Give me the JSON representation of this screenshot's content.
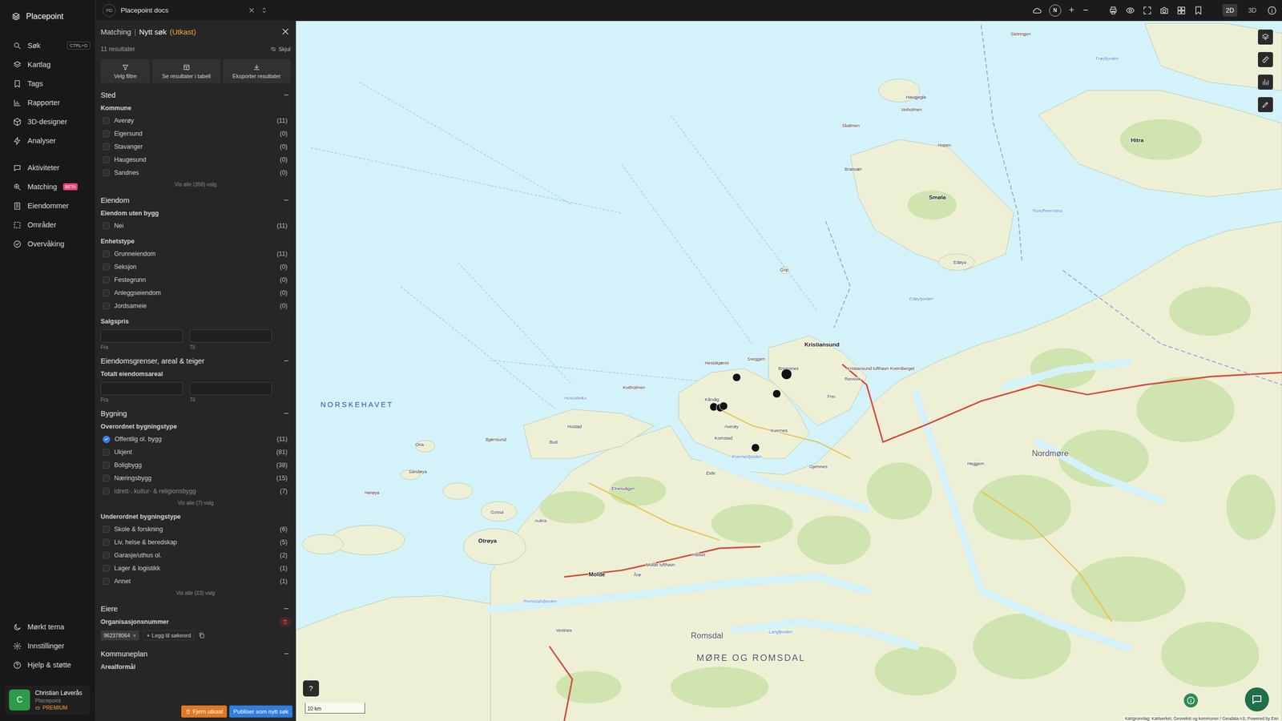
{
  "app": {
    "name": "Placepoint"
  },
  "nav": {
    "groups": [
      [
        {
          "label": "Søk",
          "shortcut": "CTRL+G"
        },
        {
          "label": "Kartlag"
        },
        {
          "label": "Tags"
        },
        {
          "label": "Rapporter"
        },
        {
          "label": "3D-designer"
        },
        {
          "label": "Analyser"
        }
      ],
      [
        {
          "label": "Aktiviteter"
        },
        {
          "label": "Matching",
          "badge": "BETA"
        },
        {
          "label": "Eiendommer"
        },
        {
          "label": "Områder"
        },
        {
          "label": "Overvåking"
        }
      ]
    ],
    "bottom": [
      {
        "label": "Mørkt tema"
      },
      {
        "label": "Innstillinger"
      },
      {
        "label": "Hjelp & støtte"
      }
    ],
    "user": {
      "initial": "C",
      "name": "Christian Løverås",
      "org": "Placepoint",
      "plan": "PREMIUM"
    }
  },
  "topbar": {
    "workspace_badge": "PD",
    "workspace": "Placepoint docs",
    "compass": "N",
    "zoom_in": "+",
    "zoom_out": "−",
    "views": [
      {
        "label": "2D",
        "selected": true
      },
      {
        "label": "3D",
        "selected": false
      }
    ]
  },
  "panel": {
    "breadcrumb": "Matching",
    "separator": "|",
    "title": "Nytt søk",
    "status": "(Utkast)",
    "results": "11 resultater",
    "hide": "Skjul",
    "actions": [
      {
        "label": "Velg filtre"
      },
      {
        "label": "Se resultater i tabell"
      },
      {
        "label": "Eksporter resultater"
      }
    ],
    "sections": [
      {
        "title": "Sted",
        "toggle": "−",
        "groups": [
          {
            "kind": "checklist",
            "label": "Kommune",
            "options": [
              {
                "label": "Averøy",
                "count": "(11)",
                "checked": false,
                "faded": false
              },
              {
                "label": "Eigersund",
                "count": "(0)",
                "checked": false,
                "faded": false
              },
              {
                "label": "Stavanger",
                "count": "(0)",
                "checked": false,
                "faded": false
              },
              {
                "label": "Haugesund",
                "count": "(0)",
                "checked": false,
                "faded": false
              },
              {
                "label": "Sandnes",
                "count": "(0)",
                "checked": false,
                "faded": false
              }
            ],
            "more": "Vis alle (358) valg"
          }
        ]
      },
      {
        "title": "Eiendom",
        "toggle": "−",
        "groups": [
          {
            "kind": "checklist",
            "label": "Eiendom uten bygg",
            "options": [
              {
                "label": "Nei",
                "count": "(11)",
                "checked": false,
                "faded": false
              }
            ],
            "more": ""
          },
          {
            "kind": "checklist",
            "label": "Enhetstype",
            "options": [
              {
                "label": "Grunneiendom",
                "count": "(11)",
                "checked": false,
                "faded": false
              },
              {
                "label": "Seksjon",
                "count": "(0)",
                "checked": false,
                "faded": false
              },
              {
                "label": "Festegrunn",
                "count": "(0)",
                "checked": false,
                "faded": false
              },
              {
                "label": "Anleggseiendom",
                "count": "(0)",
                "checked": false,
                "faded": false
              },
              {
                "label": "Jordsameie",
                "count": "(0)",
                "checked": false,
                "faded": false
              }
            ],
            "more": ""
          },
          {
            "kind": "range",
            "label": "Salgspris",
            "from": "Fra",
            "to": "Til"
          }
        ]
      },
      {
        "title": "Eiendomsgrenser, areal & teiger",
        "toggle": "−",
        "groups": [
          {
            "kind": "range",
            "label": "Totalt eiendomsareal",
            "from": "Fra",
            "to": "Til"
          }
        ]
      },
      {
        "title": "Bygning",
        "toggle": "−",
        "groups": [
          {
            "kind": "checklist",
            "label": "Overordnet bygningstype",
            "options": [
              {
                "label": "Offentlig ol. bygg",
                "count": "(11)",
                "checked": true,
                "faded": false
              },
              {
                "label": "Ukjent",
                "count": "(81)",
                "checked": false,
                "faded": false
              },
              {
                "label": "Boligbygg",
                "count": "(38)",
                "checked": false,
                "faded": false
              },
              {
                "label": "Næringsbygg",
                "count": "(15)",
                "checked": false,
                "faded": false
              },
              {
                "label": "Idrett-, kultur- & religionsbygg",
                "count": "(7)",
                "checked": false,
                "faded": true
              }
            ],
            "more": "Vis alle (7) valg"
          },
          {
            "kind": "checklist",
            "label": "Underordnet bygningstype",
            "options": [
              {
                "label": "Skole & forskning",
                "count": "(6)",
                "checked": false,
                "faded": false
              },
              {
                "label": "Liv, helse & beredskap",
                "count": "(5)",
                "checked": false,
                "faded": false
              },
              {
                "label": "Garasje/uthus ol.",
                "count": "(2)",
                "checked": false,
                "faded": false
              },
              {
                "label": "Lager & logistikk",
                "count": "(1)",
                "checked": false,
                "faded": false
              },
              {
                "label": "Annet",
                "count": "(1)",
                "checked": false,
                "faded": false
              }
            ],
            "more": "Vis alle (23) valg"
          }
        ]
      },
      {
        "title": "Eiere",
        "toggle": "−",
        "groups": [
          {
            "kind": "tags",
            "label": "Organisasjonsnummer",
            "tags": [
              {
                "label": "962378064",
                "remove": "×"
              }
            ],
            "add_icon": "+",
            "add": "Legg til søkeord"
          }
        ]
      },
      {
        "title": "Kommuneplan",
        "toggle": "−",
        "groups": [
          {
            "kind": "label",
            "label": "Arealformål"
          }
        ]
      }
    ],
    "footer": {
      "discard": "Fjern utkast",
      "publish": "Publiser som nytt søk"
    }
  },
  "map": {
    "labels": [
      {
        "text": "NORSKEHAVET",
        "kind": "sea"
      },
      {
        "text": "MØRE OG ROMSDAL",
        "kind": "region"
      },
      {
        "text": "Romsdal",
        "kind": "district"
      },
      {
        "text": "Nordmøre",
        "kind": "district"
      },
      {
        "text": "Smøla",
        "kind": "town"
      },
      {
        "text": "Hitra",
        "kind": "town"
      },
      {
        "text": "Kristiansund",
        "kind": "town"
      },
      {
        "text": "Averøy",
        "kind": "place"
      },
      {
        "text": "Kvernes",
        "kind": "place"
      },
      {
        "text": "Kornstad",
        "kind": "place"
      },
      {
        "text": "Kårvåg",
        "kind": "place"
      },
      {
        "text": "Bremsnes",
        "kind": "place"
      },
      {
        "text": "Sveggen",
        "kind": "place"
      },
      {
        "text": "Hestskjæret",
        "kind": "place"
      },
      {
        "text": "Grip",
        "kind": "place"
      },
      {
        "text": "Kvitholmen",
        "kind": "place"
      },
      {
        "text": "Hustadvika",
        "kind": "water"
      },
      {
        "text": "Bud",
        "kind": "place"
      },
      {
        "text": "Hustad",
        "kind": "place"
      },
      {
        "text": "Elnesvågen",
        "kind": "place"
      },
      {
        "text": "Bjørnsund",
        "kind": "place"
      },
      {
        "text": "Ona",
        "kind": "place"
      },
      {
        "text": "Sandøya",
        "kind": "place"
      },
      {
        "text": "Harøya",
        "kind": "place"
      },
      {
        "text": "Gossa",
        "kind": "place"
      },
      {
        "text": "Otrøya",
        "kind": "town"
      },
      {
        "text": "Molde",
        "kind": "town"
      },
      {
        "text": "Årø",
        "kind": "place"
      },
      {
        "text": "Molde lufthavn",
        "kind": "place"
      },
      {
        "text": "Eide",
        "kind": "place"
      },
      {
        "text": "Gjemnes",
        "kind": "place"
      },
      {
        "text": "Frei",
        "kind": "place"
      },
      {
        "text": "Rensvik",
        "kind": "place"
      },
      {
        "text": "Kristiansund lufthavn Kvernberget",
        "kind": "place"
      },
      {
        "text": "Edøya",
        "kind": "place"
      },
      {
        "text": "Edøyfjorden",
        "kind": "water"
      },
      {
        "text": "Trondheimsleia",
        "kind": "water"
      },
      {
        "text": "Veiholmen",
        "kind": "place"
      },
      {
        "text": "Haugjegla",
        "kind": "place"
      },
      {
        "text": "Skalmen",
        "kind": "place"
      },
      {
        "text": "Brattvær",
        "kind": "place"
      },
      {
        "text": "Hopen",
        "kind": "place"
      },
      {
        "text": "Sletringen",
        "kind": "place"
      },
      {
        "text": "Vestnes",
        "kind": "place"
      },
      {
        "text": "Romsdalsfjorden",
        "kind": "water"
      },
      {
        "text": "Langfjorden",
        "kind": "water"
      },
      {
        "text": "Kvernesfjorden",
        "kind": "water"
      },
      {
        "text": "Helset",
        "kind": "place"
      },
      {
        "text": "Aukra",
        "kind": "place"
      },
      {
        "text": "Frøyfjorden",
        "kind": "water"
      },
      {
        "text": "Heggem",
        "kind": "place"
      }
    ],
    "scale": "10 km",
    "help": "?",
    "attribution": "Kartgrunnlag: Kartverket, Geovekst og kommuner / Geodata AS; Powered by Esri"
  }
}
